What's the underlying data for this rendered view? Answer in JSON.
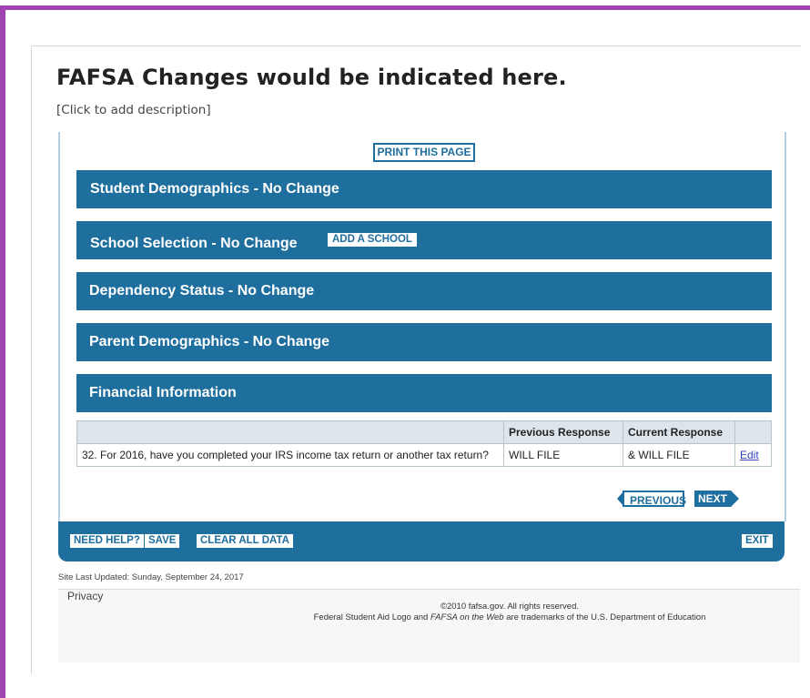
{
  "slide": {
    "title": "FAFSA Changes would be indicated here.",
    "description": "[Click to add description]"
  },
  "page": {
    "print_label": "PRINT THIS PAGE",
    "sections": [
      {
        "label": "Student Demographics - No Change"
      },
      {
        "label": "School Selection - No Change",
        "button": "ADD A SCHOOL"
      },
      {
        "label": "Dependency Status - No Change"
      },
      {
        "label": "Parent Demographics - No Change"
      },
      {
        "label": "Financial Information"
      }
    ],
    "table": {
      "headers": [
        "",
        "Previous Response",
        "Current Response",
        ""
      ],
      "rows": [
        {
          "question": "32. For 2016, have you completed your IRS income tax return or another tax return?",
          "previous": "WILL FILE",
          "current": "& WILL FILE",
          "action": "Edit"
        }
      ]
    },
    "nav": {
      "previous": "PREVIOUS",
      "next": "NEXT"
    },
    "bottom_bar": {
      "need_help": "NEED HELP?",
      "save": "SAVE",
      "clear": "CLEAR ALL DATA",
      "exit": "EXIT"
    },
    "site_updated": "Site Last Updated: Sunday, September 24, 2017",
    "footer": {
      "privacy": "Privacy",
      "copyright": "©2010 fafsa.gov. All rights reserved.",
      "trademark_pre": "Federal Student Aid Logo and ",
      "trademark_em": "FAFSA on the Web",
      "trademark_post": " are trademarks of the U.S. Department of Education"
    }
  },
  "colors": {
    "frame": "#a044b4",
    "section_blue": "#1f6f9e",
    "table_header": "#dde5ec",
    "link": "#3344bb"
  }
}
